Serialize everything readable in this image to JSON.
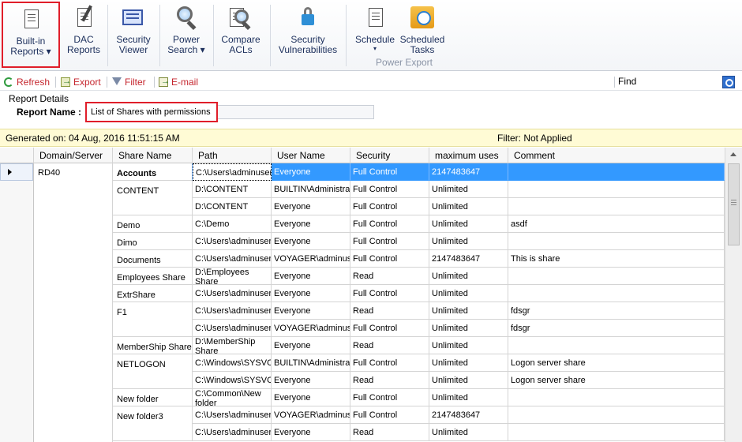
{
  "ribbon": {
    "buttons": [
      {
        "line1": "Built-in",
        "line2": "Reports",
        "dropdown": true,
        "icon": "report-doc-icon"
      },
      {
        "line1": "DAC",
        "line2": "Reports",
        "dropdown": false,
        "icon": "dac-report-icon"
      },
      {
        "line1": "Security",
        "line2": "Viewer",
        "dropdown": false,
        "icon": "monitor-icon"
      },
      {
        "line1": "Power",
        "line2": "Search",
        "dropdown": true,
        "icon": "magnifier-icon"
      },
      {
        "line1": "Compare",
        "line2": "ACLs",
        "dropdown": false,
        "icon": "compare-magnifier-icon"
      },
      {
        "line1": "Security",
        "line2": "Vulnerabilities",
        "dropdown": false,
        "icon": "lock-icon"
      },
      {
        "line1": "Schedule",
        "line2": "",
        "dropdown": true,
        "icon": "schedule-doc-icon"
      },
      {
        "line1": "Scheduled",
        "line2": "Tasks",
        "dropdown": false,
        "icon": "clock-icon"
      }
    ],
    "group_label": "Power Export",
    "dropdown_arrow": "▾"
  },
  "toolbar": {
    "refresh": "Refresh",
    "export": "Export",
    "filter": "Filter",
    "email": "E-mail",
    "find_label": "Find",
    "find_value": ""
  },
  "report_details": {
    "title": "Report Details",
    "name_label": "Report Name :",
    "name_value": "List of Shares with permissions"
  },
  "info": {
    "generated": "Generated on: 04 Aug, 2016 11:51:15 AM",
    "filter": "Filter: Not Applied"
  },
  "grid": {
    "columns": [
      "Domain/Server",
      "Share Name",
      "Path",
      "User Name",
      "Security",
      "maximum uses",
      "Comment"
    ],
    "domain": "RD40",
    "shares": [
      {
        "name": "Accounts",
        "start": 0,
        "span": 1
      },
      {
        "name": "CONTENT",
        "start": 1,
        "span": 2
      },
      {
        "name": "Demo",
        "start": 3,
        "span": 1
      },
      {
        "name": "Dimo",
        "start": 4,
        "span": 1
      },
      {
        "name": "Documents",
        "start": 5,
        "span": 1
      },
      {
        "name": "Employees Share",
        "start": 6,
        "span": 1
      },
      {
        "name": "ExtrShare",
        "start": 7,
        "span": 1
      },
      {
        "name": "F1",
        "start": 8,
        "span": 2
      },
      {
        "name": "MemberShip Share",
        "start": 10,
        "span": 1
      },
      {
        "name": "NETLOGON",
        "start": 11,
        "span": 2
      },
      {
        "name": "New folder",
        "start": 13,
        "span": 1
      },
      {
        "name": "New folder3",
        "start": 14,
        "span": 2
      }
    ],
    "rows": [
      {
        "path": "C:\\Users\\adminuser",
        "user": "Everyone",
        "security": "Full Control",
        "max": "2147483647",
        "comment": ""
      },
      {
        "path": "D:\\CONTENT",
        "user": "BUILTIN\\Administrat",
        "security": "Full Control",
        "max": "Unlimited",
        "comment": ""
      },
      {
        "path": "D:\\CONTENT",
        "user": "Everyone",
        "security": "Full Control",
        "max": "Unlimited",
        "comment": ""
      },
      {
        "path": "C:\\Demo",
        "user": "Everyone",
        "security": "Full Control",
        "max": "Unlimited",
        "comment": "asdf"
      },
      {
        "path": "C:\\Users\\adminuser",
        "user": "Everyone",
        "security": "Full Control",
        "max": "Unlimited",
        "comment": ""
      },
      {
        "path": "C:\\Users\\adminuser",
        "user": "VOYAGER\\adminuse",
        "security": "Full Control",
        "max": "2147483647",
        "comment": "This is share"
      },
      {
        "path": "D:\\Employees Share",
        "user": "Everyone",
        "security": "Read",
        "max": "Unlimited",
        "comment": "",
        "wrap": true
      },
      {
        "path": "C:\\Users\\adminuser",
        "user": "Everyone",
        "security": "Full Control",
        "max": "Unlimited",
        "comment": ""
      },
      {
        "path": "C:\\Users\\adminuser",
        "user": "Everyone",
        "security": "Read",
        "max": "Unlimited",
        "comment": "fdsgr"
      },
      {
        "path": "C:\\Users\\adminuser",
        "user": "VOYAGER\\adminuse",
        "security": "Full Control",
        "max": "Unlimited",
        "comment": "fdsgr"
      },
      {
        "path": "D:\\MemberShip Share",
        "user": "Everyone",
        "security": "Read",
        "max": "Unlimited",
        "comment": "",
        "wrap": true
      },
      {
        "path": "C:\\Windows\\SYSVOL",
        "user": "BUILTIN\\Administrat",
        "security": "Full Control",
        "max": "Unlimited",
        "comment": "Logon server share"
      },
      {
        "path": "C:\\Windows\\SYSVOL",
        "user": "Everyone",
        "security": "Read",
        "max": "Unlimited",
        "comment": "Logon server share"
      },
      {
        "path": "C:\\Common\\New folder",
        "user": "Everyone",
        "security": "Full Control",
        "max": "Unlimited",
        "comment": "",
        "wrap": true
      },
      {
        "path": "C:\\Users\\adminuser",
        "user": "VOYAGER\\adminuse",
        "security": "Full Control",
        "max": "2147483647",
        "comment": ""
      },
      {
        "path": "C:\\Users\\adminuser",
        "user": "Everyone",
        "security": "Read",
        "max": "Unlimited",
        "comment": ""
      }
    ],
    "selected_row": 0
  },
  "colors": {
    "selection": "#3399ff",
    "highlight_border": "#e01e2a",
    "info_bar": "#fffbd5",
    "toolbar_text": "#c5262e"
  }
}
